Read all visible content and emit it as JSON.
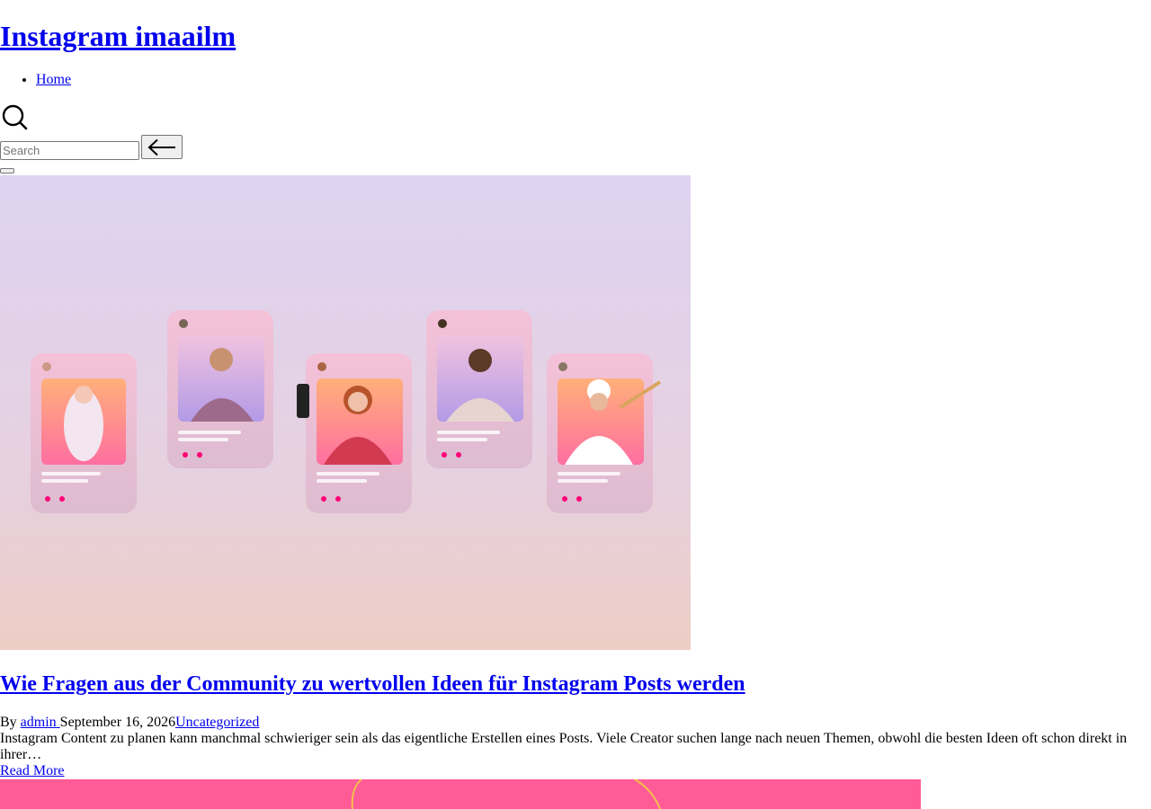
{
  "site": {
    "title": "Instagram imaailm"
  },
  "nav": {
    "items": [
      {
        "label": "Home"
      }
    ]
  },
  "search": {
    "placeholder": "Search",
    "value": ""
  },
  "post": {
    "title": "Wie Fragen aus der Community zu wertvollen Ideen für Instagram Posts werden",
    "meta": {
      "by": "By",
      "author": "admin",
      "date": "September 16, 2026",
      "category": "Uncategorized"
    },
    "excerpt": "Instagram Content zu planen kann manchmal schwieriger sein als das eigentliche Erstellen eines Posts. Viele Creator suchen lange nach neuen Themen, obwohl die besten Ideen oft schon direkt in ihrer…",
    "read_more": "Read More"
  },
  "colors": {
    "link": "#0000ee",
    "hero_top": "#ded3f1",
    "hero_bottom": "#eecdc5",
    "next_image_bg": "#ff5b97"
  },
  "icons": {
    "search": "search-icon",
    "back": "arrow-left-icon"
  }
}
